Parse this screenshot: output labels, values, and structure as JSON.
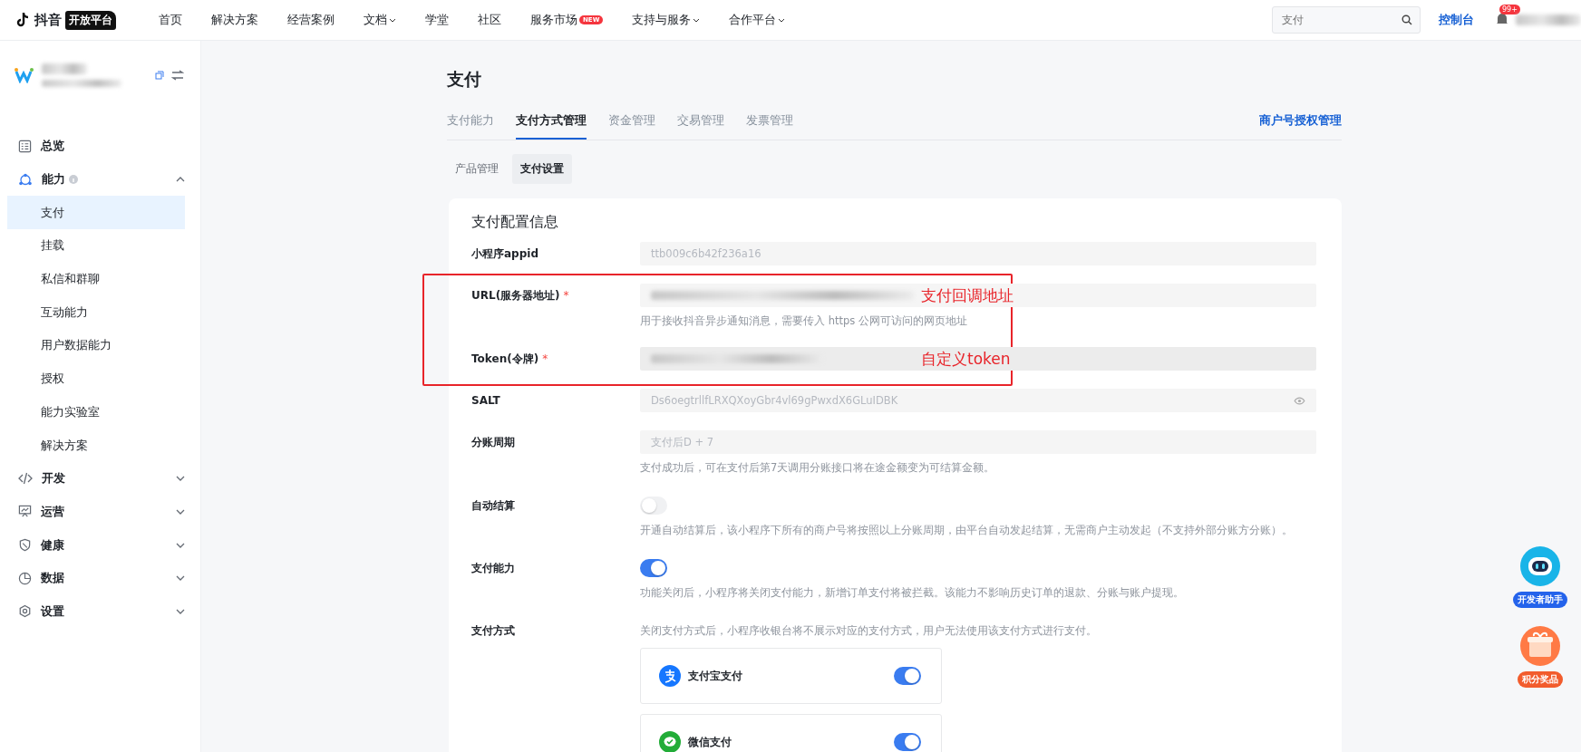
{
  "topbar": {
    "logo": {
      "brand": "抖音",
      "badge": "开放平台"
    },
    "nav": [
      {
        "label": "首页"
      },
      {
        "label": "解决方案"
      },
      {
        "label": "经营案例"
      },
      {
        "label": "文档",
        "dropdown": true
      },
      {
        "label": "学堂"
      },
      {
        "label": "社区"
      },
      {
        "label": "服务市场",
        "badge": "NEW"
      },
      {
        "label": "支持与服务",
        "dropdown": true
      },
      {
        "label": "合作平台",
        "dropdown": true
      }
    ],
    "search": {
      "placeholder": "支付"
    },
    "console": "控制台",
    "notifications": {
      "badge": "99+"
    }
  },
  "sidebar": {
    "items": [
      {
        "label": "总览"
      },
      {
        "label": "能力",
        "info": true,
        "expanded": true,
        "children": [
          {
            "label": "支付",
            "selected": true
          },
          {
            "label": "挂载",
            "selected": false
          },
          {
            "label": "私信和群聊",
            "selected": false
          },
          {
            "label": "互动能力",
            "selected": false
          },
          {
            "label": "用户数据能力",
            "selected": false
          },
          {
            "label": "授权",
            "selected": false
          },
          {
            "label": "能力实验室",
            "selected": false
          },
          {
            "label": "解决方案",
            "selected": false
          }
        ]
      },
      {
        "label": "开发",
        "expanded": false
      },
      {
        "label": "运营",
        "expanded": false
      },
      {
        "label": "健康",
        "expanded": false
      },
      {
        "label": "数据",
        "expanded": false
      },
      {
        "label": "设置",
        "expanded": false
      }
    ]
  },
  "page": {
    "title": "支付",
    "tabs": [
      {
        "label": "支付能力",
        "selected": false
      },
      {
        "label": "支付方式管理",
        "selected": true
      },
      {
        "label": "资金管理",
        "selected": false
      },
      {
        "label": "交易管理",
        "selected": false
      },
      {
        "label": "发票管理",
        "selected": false
      }
    ],
    "tab_link": "商户号授权管理",
    "subtabs": [
      {
        "label": "产品管理",
        "selected": false
      },
      {
        "label": "支付设置",
        "selected": true
      }
    ],
    "card": {
      "title": "支付配置信息",
      "rows": [
        {
          "kind": "input",
          "label": "小程序appid",
          "value": "ttb009c6b42f236a16"
        },
        {
          "kind": "input",
          "label": "URL(服务器地址)",
          "required_mark": "*",
          "blurred": true,
          "highlight": true,
          "annotation": "支付回调地址",
          "hint": "用于接收抖音异步通知消息，需要传入 https 公网可访问的网页地址"
        },
        {
          "kind": "input",
          "label": "Token(令牌)",
          "required_mark": "*",
          "blurred": true,
          "highlight": true,
          "annotation": "自定义token"
        },
        {
          "kind": "input",
          "label": "SALT",
          "value": "Ds6oegtrllfLRXQXoyGbr4vl69gPwxdX6GLuIDBK",
          "reveal": true
        },
        {
          "kind": "input",
          "label": "分账周期",
          "value": "支付后D + 7",
          "hint": "支付成功后，可在支付后第7天调用分账接口将在途金额变为可结算金额。"
        },
        {
          "kind": "toggle",
          "label": "自动结算",
          "on": false,
          "hint": "开通自动结算后，该小程序下所有的商户号将按照以上分账周期，由平台自动发起结算，无需商户主动发起（不支持外部分账方分账）。"
        },
        {
          "kind": "toggle",
          "label": "支付能力",
          "on": true,
          "hint": "功能关闭后，小程序将关闭支付能力，新增订单支付将被拦截。该能力不影响历史订单的退款、分账与账户提现。"
        },
        {
          "kind": "methods",
          "label": "支付方式",
          "hint": "关闭支付方式后，小程序收银台将不展示对应的支付方式，用户无法使用该支付方式进行支付。",
          "methods": [
            {
              "name": "支付宝支付",
              "on": true,
              "color": "#1677ff"
            },
            {
              "name": "微信支付",
              "on": true,
              "color": "#22ac38"
            }
          ]
        }
      ]
    }
  },
  "floating": [
    {
      "label": "开发者助手"
    },
    {
      "label": "积分奖品"
    }
  ]
}
